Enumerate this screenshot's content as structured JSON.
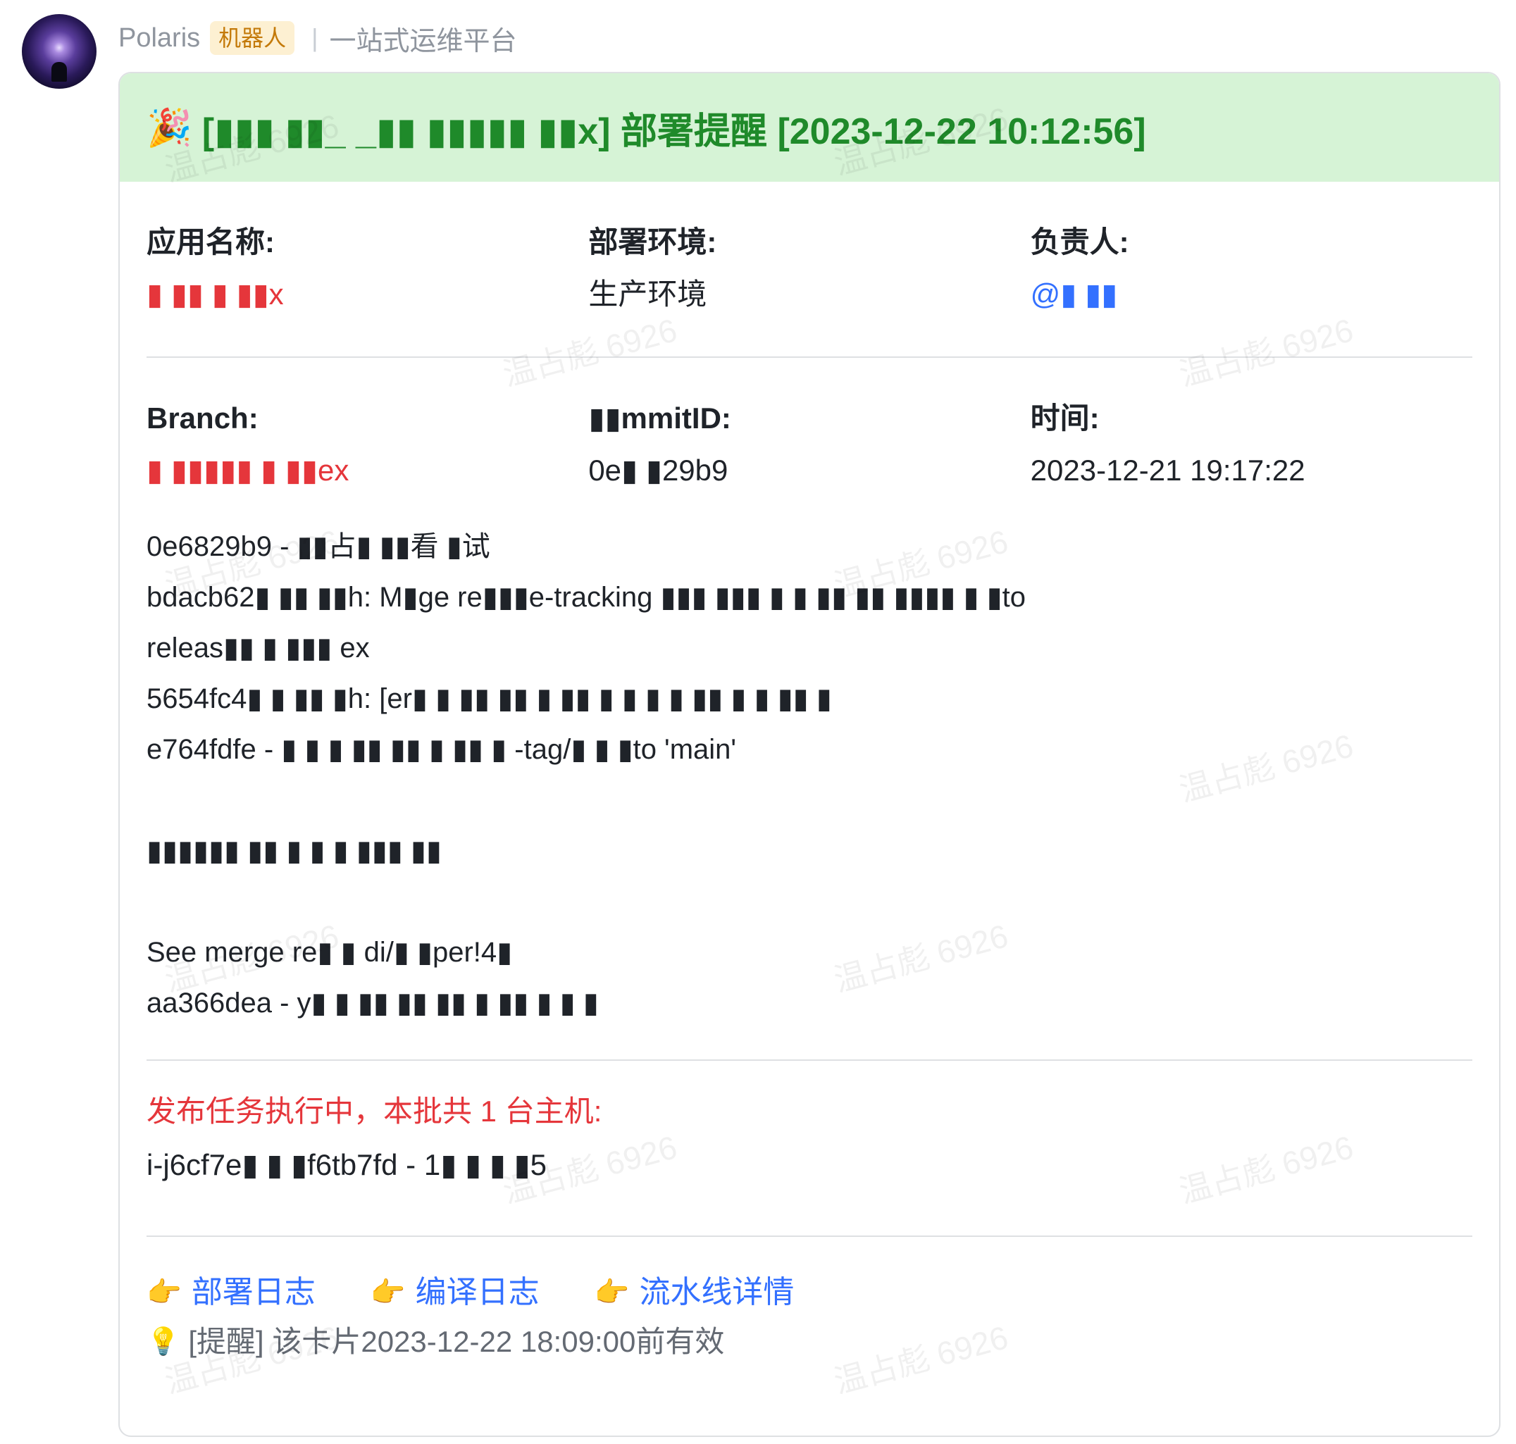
{
  "sender": {
    "name": "Polaris",
    "badge": "机器人",
    "separator": "|",
    "platform": "一站式运维平台"
  },
  "card": {
    "header_icon": "party-popper-icon",
    "title": "[▮▮▮ ▮▮_ _▮▮ ▮▮▮▮▮ ▮▮x] 部署提醒 [2023-12-22 10:12:56]",
    "fields_row1": [
      {
        "label": "应用名称:",
        "value": "▮ ▮▮ ▮ ▮▮x"
      },
      {
        "label": "部署环境:",
        "value": "生产环境"
      },
      {
        "label": "负责人:",
        "value": "@▮ ▮▮"
      }
    ],
    "fields_row2": [
      {
        "label": "Branch:",
        "value": "▮ ▮▮▮▮▮ ▮ ▮▮ex"
      },
      {
        "label": "▮▮mmitID:",
        "value": "0e▮ ▮29b9"
      },
      {
        "label": "时间:",
        "value": "2023-12-21 19:17:22"
      }
    ],
    "commit_log": [
      "0e6829b9 - ▮▮占▮ ▮▮看 ▮试",
      "bdacb62▮ ▮▮ ▮▮h: M▮ge re▮▮▮e-tracking ▮▮▮ ▮▮▮ ▮ ▮ ▮▮ ▮▮ ▮▮▮▮ ▮ ▮to",
      "releas▮▮ ▮ ▮▮▮ ex",
      "5654fc4▮ ▮ ▮▮ ▮h: [er▮ ▮ ▮▮ ▮▮ ▮ ▮▮ ▮ ▮ ▮ ▮ ▮▮ ▮ ▮ ▮▮ ▮",
      "e764fdfe - ▮ ▮ ▮ ▮▮ ▮▮ ▮ ▮▮ ▮ -tag/▮ ▮ ▮to 'main'",
      "",
      "▮▮▮▮▮▮ ▮▮ ▮ ▮ ▮ ▮▮▮ ▮▮",
      "",
      "See merge re▮ ▮ di/▮ ▮per!4▮",
      "aa366dea - y▮ ▮ ▮▮ ▮▮ ▮▮ ▮ ▮▮ ▮ ▮ ▮"
    ],
    "alert": "发布任务执行中，本批共 1 台主机:",
    "host": "i-j6cf7e▮ ▮ ▮f6tb7fd - 1▮ ▮ ▮ ▮5",
    "links": [
      {
        "icon": "pointing-hand-icon",
        "label": "部署日志"
      },
      {
        "icon": "pointing-hand-icon",
        "label": "编译日志"
      },
      {
        "icon": "pointing-hand-icon",
        "label": "流水线详情"
      }
    ],
    "tip": {
      "icon": "light-bulb-icon",
      "text": "[提醒] 该卡片2023-12-22 18:09:00前有效"
    }
  },
  "watermark": "温占彪 6926",
  "colors": {
    "header_bg": "#d6f3d6",
    "header_text": "#1f8a2a",
    "link": "#3370ff",
    "alert": "#e5363b",
    "badge_bg": "#fdf0d2",
    "badge_text": "#c47a0a"
  }
}
